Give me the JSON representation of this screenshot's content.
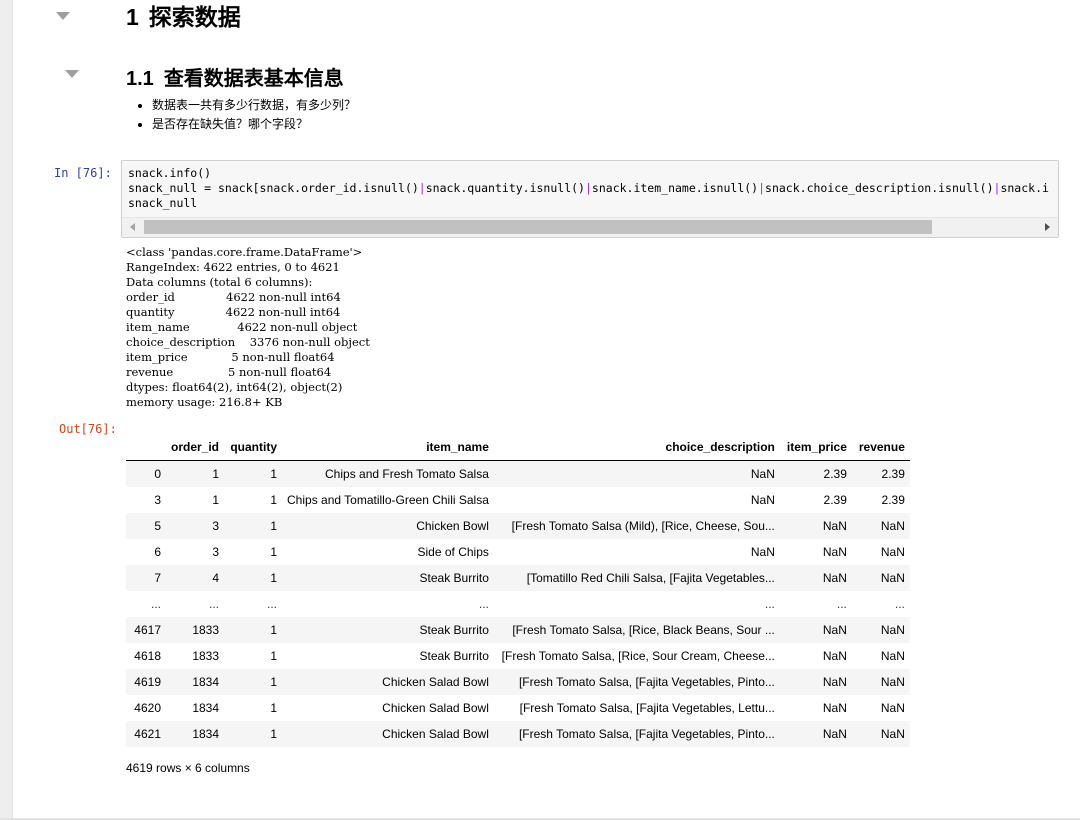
{
  "heading1": {
    "number": "1",
    "title": "探索数据"
  },
  "heading2": {
    "number": "1.1",
    "title": "查看数据表基本信息"
  },
  "bullets": [
    "数据表一共有多少行数据，有多少列？",
    "是否存在缺失值？哪个字段？"
  ],
  "code_cell": {
    "prompt": "In  [76]:",
    "line1": "snack.info()",
    "line2_parts": [
      "snack_null = snack[snack.order_id.isnull()",
      "|",
      "snack.quantity.isnull()",
      "|",
      "snack.item_name.isnull()",
      "|",
      "snack.choice_description.isnull()",
      "|",
      "snack.i"
    ],
    "line3": "snack_null"
  },
  "stdout": [
    "<class 'pandas.core.frame.DataFrame'>",
    "RangeIndex: 4622 entries, 0 to 4621",
    "Data columns (total 6 columns):",
    "order_id              4622 non-null int64",
    "quantity              4622 non-null int64",
    "item_name             4622 non-null object",
    "choice_description    3376 non-null object",
    "item_price            5 non-null float64",
    "revenue               5 non-null float64",
    "dtypes: float64(2), int64(2), object(2)",
    "memory usage: 216.8+ KB"
  ],
  "output": {
    "prompt": "Out[76]:",
    "columns": [
      "",
      "order_id",
      "quantity",
      "item_name",
      "choice_description",
      "item_price",
      "revenue"
    ],
    "rows": [
      [
        "0",
        "1",
        "1",
        "Chips and Fresh Tomato Salsa",
        "NaN",
        "2.39",
        "2.39"
      ],
      [
        "3",
        "1",
        "1",
        "Chips and Tomatillo-Green Chili Salsa",
        "NaN",
        "2.39",
        "2.39"
      ],
      [
        "5",
        "3",
        "1",
        "Chicken Bowl",
        "[Fresh Tomato Salsa (Mild), [Rice, Cheese, Sou...",
        "NaN",
        "NaN"
      ],
      [
        "6",
        "3",
        "1",
        "Side of Chips",
        "NaN",
        "NaN",
        "NaN"
      ],
      [
        "7",
        "4",
        "1",
        "Steak Burrito",
        "[Tomatillo Red Chili Salsa, [Fajita Vegetables...",
        "NaN",
        "NaN"
      ],
      [
        "...",
        "...",
        "...",
        "...",
        "...",
        "...",
        "..."
      ],
      [
        "4617",
        "1833",
        "1",
        "Steak Burrito",
        "[Fresh Tomato Salsa, [Rice, Black Beans, Sour ...",
        "NaN",
        "NaN"
      ],
      [
        "4618",
        "1833",
        "1",
        "Steak Burrito",
        "[Fresh Tomato Salsa, [Rice, Sour Cream, Cheese...",
        "NaN",
        "NaN"
      ],
      [
        "4619",
        "1834",
        "1",
        "Chicken Salad Bowl",
        "[Fresh Tomato Salsa, [Fajita Vegetables, Pinto...",
        "NaN",
        "NaN"
      ],
      [
        "4620",
        "1834",
        "1",
        "Chicken Salad Bowl",
        "[Fresh Tomato Salsa, [Fajita Vegetables, Lettu...",
        "NaN",
        "NaN"
      ],
      [
        "4621",
        "1834",
        "1",
        "Chicken Salad Bowl",
        "[Fresh Tomato Salsa, [Fajita Vegetables, Pinto...",
        "NaN",
        "NaN"
      ]
    ],
    "shape_text": "4619 rows × 6 columns"
  }
}
